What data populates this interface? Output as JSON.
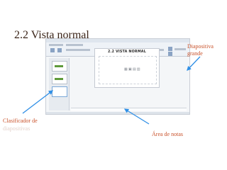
{
  "slide": {
    "heading": "2.2 Vista normal",
    "labels": {
      "large_slide_line1": "Diapositiva",
      "large_slide_line2": "grande",
      "sorter_line1": "Clasificador de",
      "sorter_line2": "diapositivas",
      "notes_area": "Área de notas"
    }
  },
  "screenshot": {
    "slide_title": "2.2 VISTA NORMAL",
    "placeholder_icons": "▦ ▣ ▤ ▥"
  },
  "colors": {
    "heading": "#3a2418",
    "label": "#c9522b",
    "arrow": "#2f8fe6",
    "ribbon_green": "#5f9a3b"
  }
}
